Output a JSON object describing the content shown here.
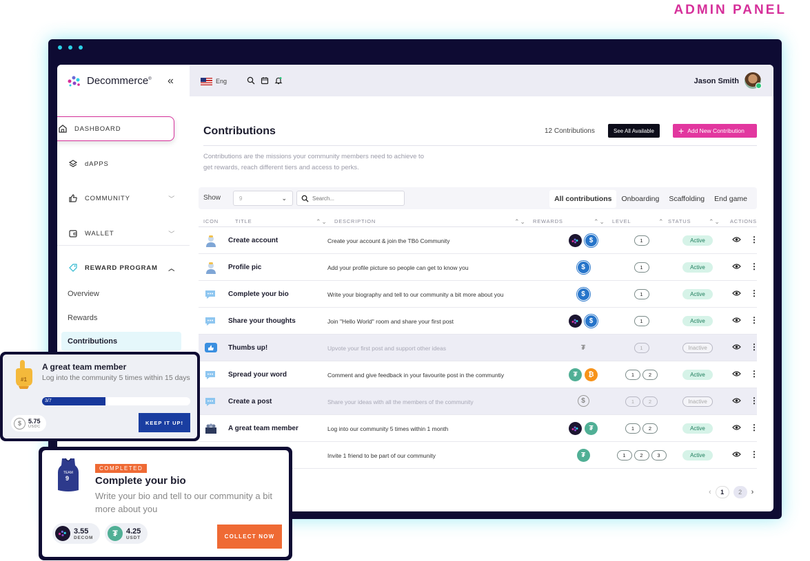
{
  "header_label": "ADMIN PANEL",
  "brand": {
    "name": "Decommerce",
    "mark": "®"
  },
  "sidebar": {
    "items": [
      {
        "label": "DASHBOARD"
      },
      {
        "label": "dAPPS"
      },
      {
        "label": "COMMUNITY"
      },
      {
        "label": "WALLET"
      },
      {
        "label": "REWARD PROGRAM"
      }
    ],
    "sub_items": [
      {
        "label": "Overview"
      },
      {
        "label": "Rewards"
      },
      {
        "label": "Contributions"
      }
    ]
  },
  "topbar": {
    "language": "Eng",
    "user_name": "Jason Smith"
  },
  "main": {
    "title": "Contributions",
    "count_text": "12 Contributions",
    "see_all_label": "See All Available",
    "add_label": "Add New Contribution",
    "description": "Contributions are the missions your community members need to achieve to get rewards, reach different tiers and access to perks.",
    "show_label": "Show",
    "show_value": "9",
    "search_placeholder": "Search...",
    "tabs": [
      "All contributions",
      "Onboarding",
      "Scaffolding",
      "End game"
    ],
    "columns": [
      "ICON",
      "TITLE",
      "DESCRIPTION",
      "REWARDS",
      "LEVEL",
      "STATUS",
      "ACTIONS"
    ],
    "rows": [
      {
        "icon": "user-avatar-icon",
        "title": "Create account",
        "description": "Create your account & join the TBō Community",
        "rewards": [
          "decom",
          "usdc"
        ],
        "levels": [
          "1"
        ],
        "status": "Active",
        "active": true
      },
      {
        "icon": "user-avatar-icon",
        "title": "Profile pic",
        "description": "Add your profile picture so people can get to know you",
        "rewards": [
          "usdc"
        ],
        "levels": [
          "1"
        ],
        "status": "Active",
        "active": true
      },
      {
        "icon": "chat-bubble-icon",
        "title": "Complete your bio",
        "description": "Write your biography and tell to our community a bit more about you",
        "rewards": [
          "usdc"
        ],
        "levels": [
          "1"
        ],
        "status": "Active",
        "active": true
      },
      {
        "icon": "chat-bubble-icon",
        "title": "Share your thoughts",
        "description": "Join \"Hello World\" room and share your first post",
        "rewards": [
          "decom",
          "usdc"
        ],
        "levels": [
          "1"
        ],
        "status": "Active",
        "active": true
      },
      {
        "icon": "thumbs-up-icon",
        "title": "Thumbs up!",
        "description": "Upvote your first post and support other ideas",
        "rewards": [
          "usdt-gray"
        ],
        "levels": [
          "1"
        ],
        "status": "Inactive",
        "active": false
      },
      {
        "icon": "chat-bubble-icon",
        "title": "Spread your word",
        "description": "Comment and give feedback in your favourite post in the communtiy",
        "rewards": [
          "usdt",
          "btc"
        ],
        "levels": [
          "1",
          "2"
        ],
        "status": "Active",
        "active": true
      },
      {
        "icon": "chat-bubble-icon",
        "title": "Create a post",
        "description": "Share your ideas with all the members of the community",
        "rewards": [
          "usdc-gray"
        ],
        "levels": [
          "1",
          "2"
        ],
        "status": "Inactive",
        "active": false
      },
      {
        "icon": "team-icon",
        "title": "A great team member",
        "description": "Log into our community 5 times within 1 month",
        "rewards": [
          "decom",
          "usdt"
        ],
        "levels": [
          "1",
          "2"
        ],
        "status": "Active",
        "active": true
      },
      {
        "icon": "",
        "title": "",
        "description": "Invite 1 friend to be part of our community",
        "rewards": [
          "usdt"
        ],
        "levels": [
          "1",
          "2",
          "3"
        ],
        "status": "Active",
        "active": true
      }
    ],
    "pagination": {
      "pages": [
        "1",
        "2"
      ],
      "current": "1"
    }
  },
  "card_team": {
    "title": "A great team member",
    "description": "Log into the community 5 times within 15 days",
    "progress_text": "3/7",
    "progress_fraction": 0.43,
    "reward_amount": "5.75",
    "reward_token": "USDC",
    "button_label": "KEEP IT UP!"
  },
  "card_bio": {
    "badge": "COMPLETED",
    "title": "Complete your bio",
    "description": "Write your bio and tell to our community a bit more about you",
    "reward1_amount": "3.55",
    "reward1_token": "DECOM",
    "reward2_amount": "4.25",
    "reward2_token": "USDT",
    "button_label": "COLLECT NOW"
  },
  "colors": {
    "accent": "#e2379f",
    "frame": "#0e0b33",
    "glow": "#2cd0e6",
    "active_green": "#d6f3e8",
    "orange": "#ef6a34",
    "blue": "#1a3ea1"
  }
}
